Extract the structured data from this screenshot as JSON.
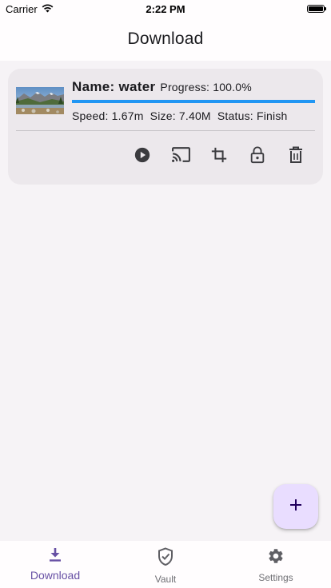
{
  "status_bar": {
    "carrier": "Carrier",
    "time": "2:22 PM"
  },
  "app_bar": {
    "title": "Download"
  },
  "download_item": {
    "name": "Name: water",
    "progress": "Progress: 100.0%",
    "progress_fraction": 1.0,
    "speed": "Speed: 1.67m",
    "size": "Size: 7.40M",
    "status": "Status: Finish",
    "actions": [
      "play-icon",
      "cast-icon",
      "crop-icon",
      "lock-open-icon",
      "delete-icon"
    ]
  },
  "fab": {
    "icon": "plus-icon"
  },
  "bottom_nav": {
    "items": [
      {
        "label": "Download",
        "icon": "download-icon",
        "active": true
      },
      {
        "label": "Vault",
        "icon": "shield-check-icon",
        "active": false
      },
      {
        "label": "Settings",
        "icon": "gear-icon",
        "active": false
      }
    ]
  },
  "colors": {
    "accent": "#6750a4",
    "progress": "#2196f3",
    "fab_bg": "#e9ddff",
    "card_bg": "#ece8ec"
  }
}
